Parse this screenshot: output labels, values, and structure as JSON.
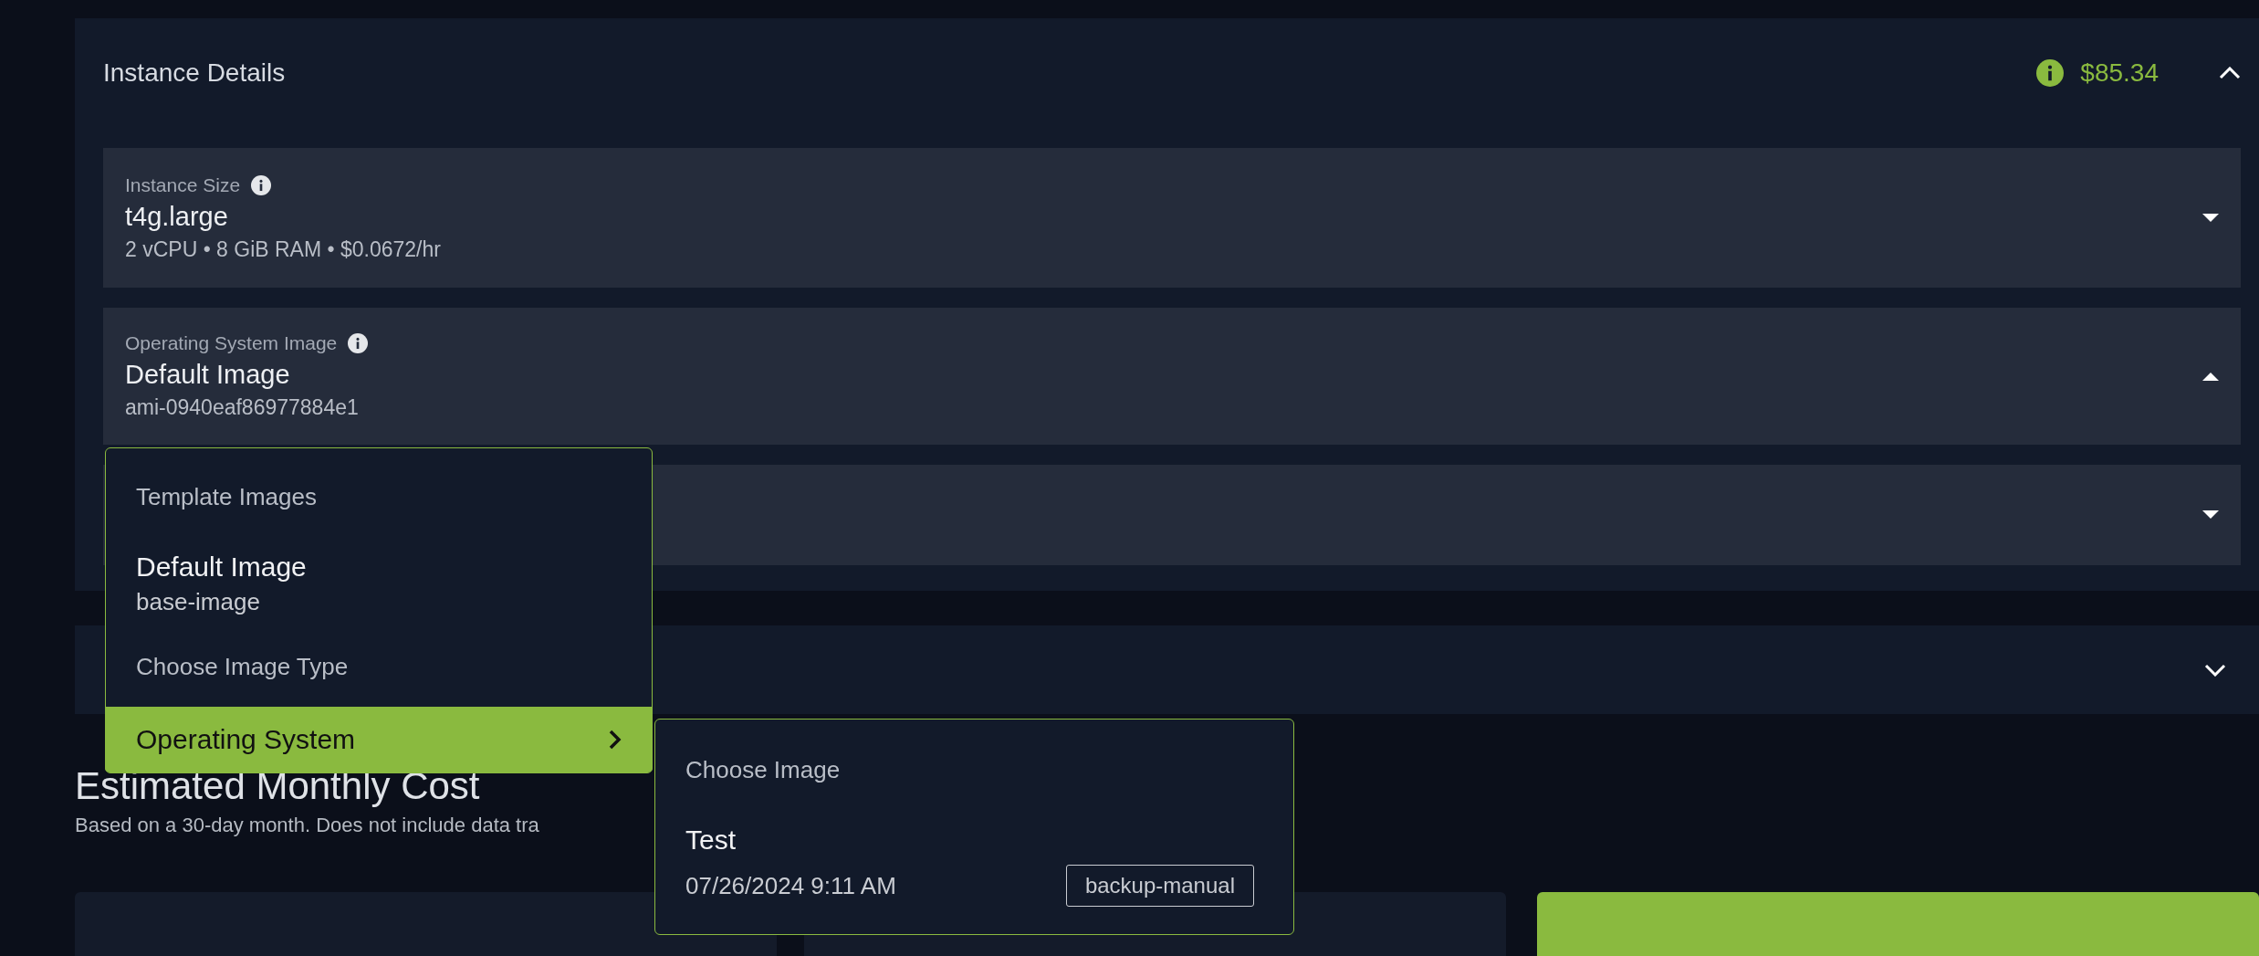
{
  "instance_details": {
    "title": "Instance Details",
    "expanded": true,
    "price": "$85.34",
    "fields": [
      {
        "label": "Instance Size",
        "value": "t4g.large",
        "detail": "2 vCPU • 8 GiB RAM • $0.0672/hr",
        "open": false
      },
      {
        "label": "Operating System Image",
        "value": "Default Image",
        "detail": "ami-0940eaf86977884e1",
        "open": true
      },
      {
        "open": false
      }
    ]
  },
  "second_section": {
    "expanded": false
  },
  "cost": {
    "title": "Estimated Monthly Cost",
    "subtitle": "Based on a 30-day month. Does not include data tra",
    "cards": [
      {
        "highlighted": false
      },
      {
        "highlighted": false
      },
      {
        "highlighted": true
      }
    ]
  },
  "image_menu": {
    "items": [
      {
        "kind": "header",
        "text": "Template Images"
      },
      {
        "kind": "option",
        "title": "Default Image",
        "subtitle": "base-image"
      },
      {
        "kind": "header",
        "text": "Choose Image Type"
      },
      {
        "kind": "submenu",
        "text": "Operating System",
        "selected": true
      }
    ]
  },
  "submenu": {
    "header": "Choose Image",
    "items": [
      {
        "title": "Test",
        "date": "07/26/2024 9:11 AM",
        "tag": "backup-manual"
      }
    ]
  }
}
